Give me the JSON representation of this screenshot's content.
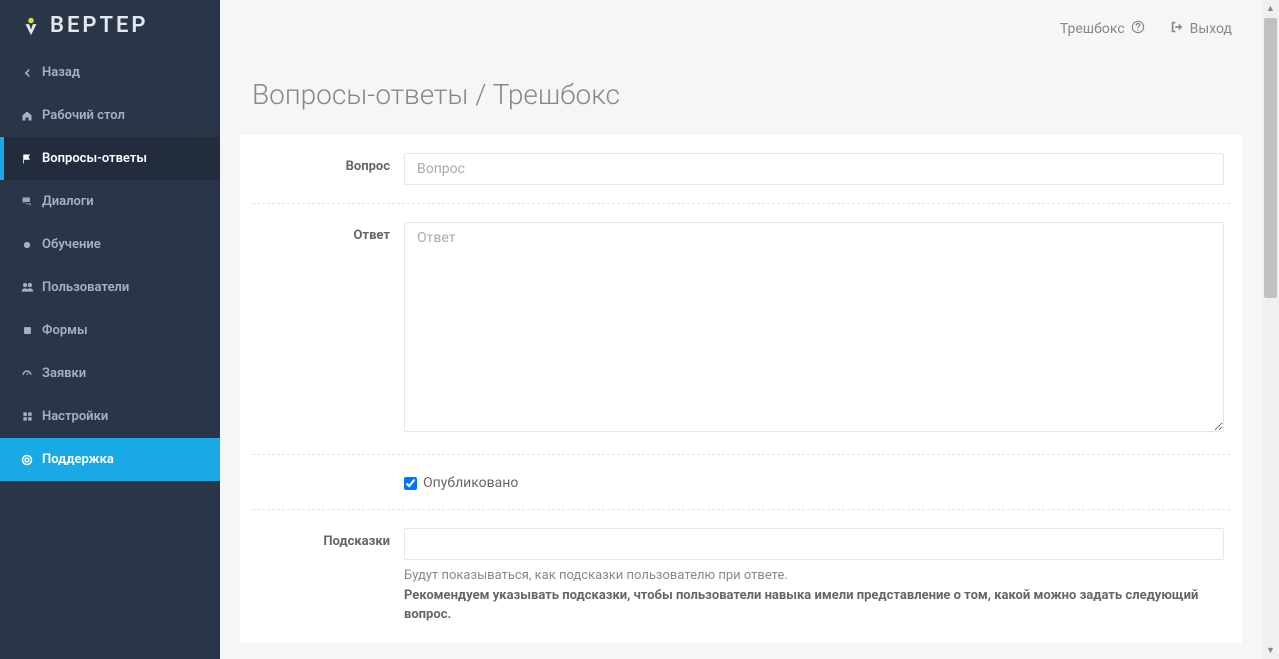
{
  "logo_text": "ВЕРТЕР",
  "sidebar": {
    "items": [
      {
        "id": "back",
        "label": "Назад",
        "icon": "arrow-left"
      },
      {
        "id": "dashboard",
        "label": "Рабочий стол",
        "icon": "home"
      },
      {
        "id": "faq",
        "label": "Вопросы-ответы",
        "icon": "flag",
        "active": true
      },
      {
        "id": "dialogs",
        "label": "Диалоги",
        "icon": "comments"
      },
      {
        "id": "learning",
        "label": "Обучение",
        "icon": "circle"
      },
      {
        "id": "users",
        "label": "Пользователи",
        "icon": "users"
      },
      {
        "id": "forms",
        "label": "Формы",
        "icon": "square"
      },
      {
        "id": "orders",
        "label": "Заявки",
        "icon": "dashboard"
      },
      {
        "id": "settings",
        "label": "Настройки",
        "icon": "grid"
      },
      {
        "id": "support",
        "label": "Поддержка",
        "icon": "life-ring",
        "highlight": true
      }
    ]
  },
  "topbar": {
    "project_label": "Трешбокс",
    "logout_label": "Выход"
  },
  "page": {
    "title": "Вопросы-ответы / Трешбокс"
  },
  "form": {
    "question": {
      "label": "Вопрос",
      "placeholder": "Вопрос",
      "value": ""
    },
    "answer": {
      "label": "Ответ",
      "placeholder": "Ответ",
      "value": ""
    },
    "published": {
      "label": "Опубликовано",
      "checked": true
    },
    "hints": {
      "label": "Подсказки",
      "value": "",
      "help_text": "Будут показываться, как подсказки пользователю при ответе.",
      "help_text_bold": "Рекомендуем указывать подсказки, чтобы пользователи навыка имели представление о том, какой можно задать следующий вопрос."
    }
  }
}
